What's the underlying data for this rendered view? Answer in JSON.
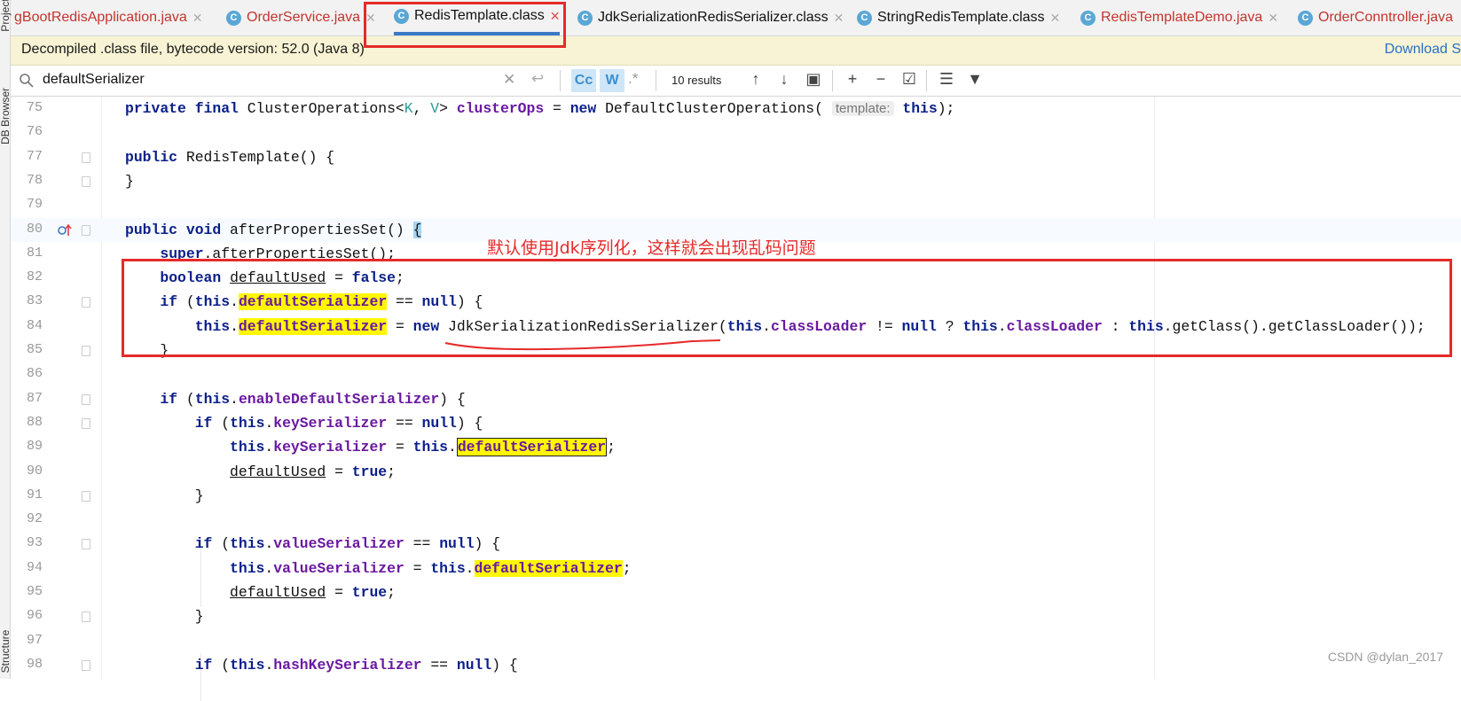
{
  "sidebar": {
    "project_label": "Project",
    "db_browser_label": "DB Browser",
    "structure_label": "Structure"
  },
  "tabs": [
    {
      "label": "gBootRedisApplication.java",
      "icon": "java-class-icon",
      "active": false,
      "color": "#c2352e"
    },
    {
      "label": "OrderService.java",
      "icon": "java-class-icon",
      "active": false,
      "color": "#c2352e"
    },
    {
      "label": "RedisTemplate.class",
      "icon": "compiled-class-icon",
      "active": true,
      "color": "#111111"
    },
    {
      "label": "JdkSerializationRedisSerializer.class",
      "icon": "compiled-class-icon",
      "active": false,
      "color": "#111111"
    },
    {
      "label": "StringRedisTemplate.class",
      "icon": "compiled-class-icon",
      "active": false,
      "color": "#111111"
    },
    {
      "label": "RedisTemplateDemo.java",
      "icon": "java-class-icon",
      "active": false,
      "color": "#c2352e"
    },
    {
      "label": "OrderConntroller.java",
      "icon": "java-class-icon",
      "active": false,
      "color": "#c2352e"
    }
  ],
  "banner": {
    "message": "Decompiled .class file, bytecode version: 52.0 (Java 8)",
    "download_link": "Download S"
  },
  "find": {
    "query": "defaultSerializer",
    "match_case_label": "Cc",
    "words_label": "W",
    "regex_label": ".*",
    "results": "10 results"
  },
  "code": {
    "lines": [
      {
        "n": "75"
      },
      {
        "n": "76"
      },
      {
        "n": "77"
      },
      {
        "n": "78"
      },
      {
        "n": "79"
      },
      {
        "n": "80"
      },
      {
        "n": "81"
      },
      {
        "n": "82"
      },
      {
        "n": "83"
      },
      {
        "n": "84"
      },
      {
        "n": "85"
      },
      {
        "n": "86"
      },
      {
        "n": "87"
      },
      {
        "n": "88"
      },
      {
        "n": "89"
      },
      {
        "n": "90"
      },
      {
        "n": "91"
      },
      {
        "n": "92"
      },
      {
        "n": "93"
      },
      {
        "n": "94"
      },
      {
        "n": "95"
      },
      {
        "n": "96"
      },
      {
        "n": "97"
      },
      {
        "n": "98"
      }
    ],
    "param_hint": "template:"
  },
  "annotation": "默认使用Jdk序列化，这样就会出现乱码问题",
  "watermark": "CSDN @dylan_2017",
  "colors": {
    "accent_red": "#e52a2a",
    "keyword": "#0b1f8a",
    "field": "#6a1aa0",
    "search_highlight": "#fff700",
    "banner_bg": "#f7f3d4",
    "link": "#2a6fc9"
  }
}
